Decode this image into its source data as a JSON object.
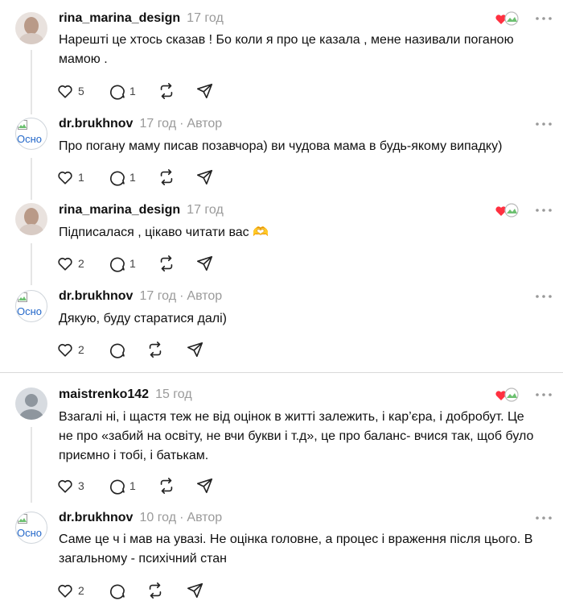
{
  "posts": [
    {
      "username": "rina_marina_design",
      "time": "17 год",
      "text": "Нарешті це хтось сказав ! Бо коли я про це казала , мене називали поганою мамою .",
      "likes": "5",
      "replies": "1",
      "avatar": "photo",
      "has_badge": true
    },
    {
      "username": "dr.brukhnov",
      "time": "17 год",
      "separator": "·",
      "author_label": "Автор",
      "text": "Про погану маму писав позавчора) ви чудова мама в будь-якому випадку)",
      "likes": "1",
      "replies": "1",
      "avatar_alt": "Осно",
      "avatar": "broken",
      "has_badge": false
    },
    {
      "username": "rina_marina_design",
      "time": "17 год",
      "text": "Підписалася , цікаво читати вас 🫶",
      "likes": "2",
      "replies": "1",
      "avatar": "photo",
      "has_badge": true
    },
    {
      "username": "dr.brukhnov",
      "time": "17 год",
      "separator": "·",
      "author_label": "Автор",
      "text": "Дякую, буду старатися далі)",
      "likes": "2",
      "replies": "",
      "avatar_alt": "Осно",
      "avatar": "broken",
      "has_badge": false
    },
    {
      "username": "maistrenko142",
      "time": "15 год",
      "text": "Взагалі ні, і щастя теж не від оцінок в житті залежить, і кар’єра, і добробут. Це не про «забий на освіту, не вчи букви і т.д», це про баланс- вчися так, щоб було приємно і тобі, і батькам.",
      "likes": "3",
      "replies": "1",
      "avatar": "grey",
      "has_badge": true
    },
    {
      "username": "dr.brukhnov",
      "time": "10 год",
      "separator": "·",
      "author_label": "Автор",
      "text": "Саме це ч і мав на увазі. Не оцінка головне, а процес і враження після цього. В загальному - психічний стан",
      "likes": "2",
      "replies": "",
      "avatar_alt": "Осно",
      "avatar": "broken",
      "has_badge": false
    }
  ],
  "icons": {
    "like": "heart-icon",
    "reply": "comment-icon",
    "repost": "repost-icon",
    "share": "send-icon",
    "more": "more-icon"
  },
  "colors": {
    "text": "#101010",
    "muted": "#9a9a9a",
    "badge_heart": "#ff3040"
  }
}
